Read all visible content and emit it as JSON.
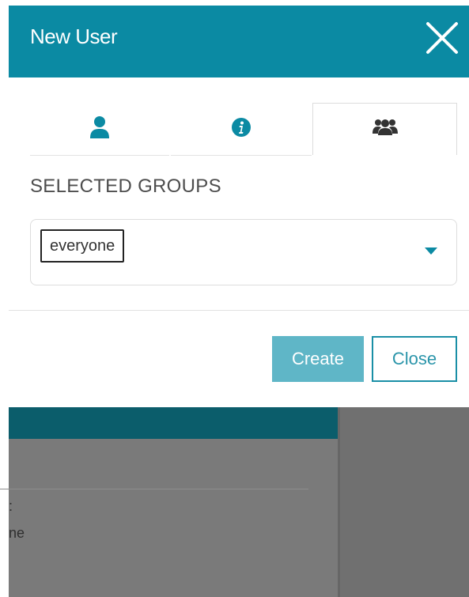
{
  "dialog": {
    "title": "New User",
    "close_icon": "close-x-icon"
  },
  "tabs": [
    {
      "icon": "user-icon",
      "active": false
    },
    {
      "icon": "info-icon",
      "active": false
    },
    {
      "icon": "group-icon",
      "active": true
    }
  ],
  "groups": {
    "label": "SELECTED GROUPS",
    "selected": [
      "everyone"
    ],
    "dropdown_icon": "caret-down-icon"
  },
  "buttons": {
    "create_label": "Create",
    "close_label": "Close"
  },
  "background": {
    "text_line_1": ":",
    "text_line_2": "ne"
  },
  "colors": {
    "accent": "#0b8aa3",
    "create_button": "#5fb6c7",
    "close_border": "#1a8fa6",
    "backdrop": "#6f6f6f"
  }
}
